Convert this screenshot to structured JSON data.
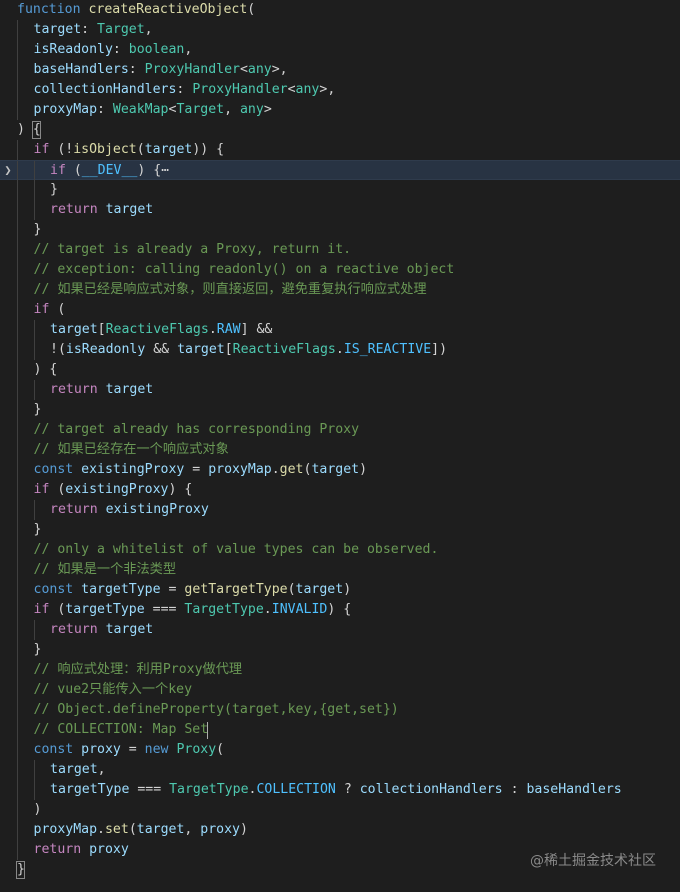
{
  "watermark": "@稀土掘金技术社区",
  "lines": [
    {
      "indent": 0,
      "tokens": [
        [
          "function ",
          "kw"
        ],
        [
          "createReactiveObject",
          "fn"
        ],
        [
          "(",
          "pun"
        ]
      ]
    },
    {
      "indent": 1,
      "tokens": [
        [
          "target",
          "var"
        ],
        [
          ": ",
          "pun"
        ],
        [
          "Target",
          "type"
        ],
        [
          ",",
          "pun"
        ]
      ]
    },
    {
      "indent": 1,
      "tokens": [
        [
          "isReadonly",
          "var"
        ],
        [
          ": ",
          "pun"
        ],
        [
          "boolean",
          "type"
        ],
        [
          ",",
          "pun"
        ]
      ]
    },
    {
      "indent": 1,
      "tokens": [
        [
          "baseHandlers",
          "var"
        ],
        [
          ": ",
          "pun"
        ],
        [
          "ProxyHandler",
          "type"
        ],
        [
          "<",
          "pun"
        ],
        [
          "any",
          "type"
        ],
        [
          ">,",
          "pun"
        ]
      ]
    },
    {
      "indent": 1,
      "tokens": [
        [
          "collectionHandlers",
          "var"
        ],
        [
          ": ",
          "pun"
        ],
        [
          "ProxyHandler",
          "type"
        ],
        [
          "<",
          "pun"
        ],
        [
          "any",
          "type"
        ],
        [
          ">,",
          "pun"
        ]
      ]
    },
    {
      "indent": 1,
      "tokens": [
        [
          "proxyMap",
          "var"
        ],
        [
          ": ",
          "pun"
        ],
        [
          "WeakMap",
          "type"
        ],
        [
          "<",
          "pun"
        ],
        [
          "Target",
          "type"
        ],
        [
          ", ",
          "pun"
        ],
        [
          "any",
          "type"
        ],
        [
          ">",
          "pun"
        ]
      ]
    },
    {
      "indent": 0,
      "tokens": [
        [
          ") {",
          "pun"
        ]
      ]
    },
    {
      "indent": 1,
      "tokens": [
        [
          "if ",
          "ctl"
        ],
        [
          "(!",
          "pun"
        ],
        [
          "isObject",
          "fn"
        ],
        [
          "(",
          "pun"
        ],
        [
          "target",
          "var"
        ],
        [
          ")) {",
          "pun"
        ]
      ]
    },
    {
      "indent": 2,
      "current": true,
      "tokens": [
        [
          "if ",
          "ctl"
        ],
        [
          "(",
          "pun"
        ],
        [
          "__DEV__",
          "cst"
        ],
        [
          ") {",
          "pun"
        ],
        [
          "⋯",
          "fold"
        ]
      ]
    },
    {
      "indent": 2,
      "tokens": [
        [
          "}",
          "pun"
        ]
      ]
    },
    {
      "indent": 2,
      "tokens": [
        [
          "return ",
          "ctl"
        ],
        [
          "target",
          "var"
        ]
      ]
    },
    {
      "indent": 1,
      "tokens": [
        [
          "}",
          "pun"
        ]
      ]
    },
    {
      "indent": 1,
      "tokens": [
        [
          "// target is already a Proxy, return it.",
          "cmt"
        ]
      ]
    },
    {
      "indent": 1,
      "tokens": [
        [
          "// exception: calling readonly() on a reactive object",
          "cmt"
        ]
      ]
    },
    {
      "indent": 1,
      "tokens": [
        [
          "// 如果已经是响应式对象，则直接返回，避免重复执行响应式处理",
          "cmt"
        ]
      ]
    },
    {
      "indent": 1,
      "tokens": [
        [
          "if ",
          "ctl"
        ],
        [
          "(",
          "pun"
        ]
      ]
    },
    {
      "indent": 2,
      "tokens": [
        [
          "target",
          "var"
        ],
        [
          "[",
          "pun"
        ],
        [
          "ReactiveFlags",
          "type"
        ],
        [
          ".",
          "pun"
        ],
        [
          "RAW",
          "cst"
        ],
        [
          "] &&",
          "pun"
        ]
      ]
    },
    {
      "indent": 2,
      "tokens": [
        [
          "!(",
          "pun"
        ],
        [
          "isReadonly",
          "var"
        ],
        [
          " && ",
          "pun"
        ],
        [
          "target",
          "var"
        ],
        [
          "[",
          "pun"
        ],
        [
          "ReactiveFlags",
          "type"
        ],
        [
          ".",
          "pun"
        ],
        [
          "IS_REACTIVE",
          "cst"
        ],
        [
          "])",
          "pun"
        ]
      ]
    },
    {
      "indent": 1,
      "tokens": [
        [
          ") {",
          "pun"
        ]
      ]
    },
    {
      "indent": 2,
      "tokens": [
        [
          "return ",
          "ctl"
        ],
        [
          "target",
          "var"
        ]
      ]
    },
    {
      "indent": 1,
      "tokens": [
        [
          "}",
          "pun"
        ]
      ]
    },
    {
      "indent": 1,
      "tokens": [
        [
          "// target already has corresponding Proxy",
          "cmt"
        ]
      ]
    },
    {
      "indent": 1,
      "tokens": [
        [
          "// 如果已经存在一个响应式对象",
          "cmt"
        ]
      ]
    },
    {
      "indent": 1,
      "tokens": [
        [
          "const ",
          "kw"
        ],
        [
          "existingProxy",
          "var"
        ],
        [
          " = ",
          "pun"
        ],
        [
          "proxyMap",
          "var"
        ],
        [
          ".",
          "pun"
        ],
        [
          "get",
          "fn"
        ],
        [
          "(",
          "pun"
        ],
        [
          "target",
          "var"
        ],
        [
          ")",
          "pun"
        ]
      ]
    },
    {
      "indent": 1,
      "tokens": [
        [
          "if ",
          "ctl"
        ],
        [
          "(",
          "pun"
        ],
        [
          "existingProxy",
          "var"
        ],
        [
          ") {",
          "pun"
        ]
      ]
    },
    {
      "indent": 2,
      "tokens": [
        [
          "return ",
          "ctl"
        ],
        [
          "existingProxy",
          "var"
        ]
      ]
    },
    {
      "indent": 1,
      "tokens": [
        [
          "}",
          "pun"
        ]
      ]
    },
    {
      "indent": 1,
      "tokens": [
        [
          "// only a whitelist of value types can be observed.",
          "cmt"
        ]
      ]
    },
    {
      "indent": 1,
      "tokens": [
        [
          "// 如果是一个非法类型",
          "cmt"
        ]
      ]
    },
    {
      "indent": 1,
      "tokens": [
        [
          "const ",
          "kw"
        ],
        [
          "targetType",
          "var"
        ],
        [
          " = ",
          "pun"
        ],
        [
          "getTargetType",
          "fn"
        ],
        [
          "(",
          "pun"
        ],
        [
          "target",
          "var"
        ],
        [
          ")",
          "pun"
        ]
      ]
    },
    {
      "indent": 1,
      "tokens": [
        [
          "if ",
          "ctl"
        ],
        [
          "(",
          "pun"
        ],
        [
          "targetType",
          "var"
        ],
        [
          " === ",
          "pun"
        ],
        [
          "TargetType",
          "type"
        ],
        [
          ".",
          "pun"
        ],
        [
          "INVALID",
          "cst"
        ],
        [
          ") {",
          "pun"
        ]
      ]
    },
    {
      "indent": 2,
      "tokens": [
        [
          "return ",
          "ctl"
        ],
        [
          "target",
          "var"
        ]
      ]
    },
    {
      "indent": 1,
      "tokens": [
        [
          "}",
          "pun"
        ]
      ]
    },
    {
      "indent": 1,
      "tokens": [
        [
          "// 响应式处理：利用Proxy做代理",
          "cmt"
        ]
      ]
    },
    {
      "indent": 1,
      "tokens": [
        [
          "// vue2只能传入一个key",
          "cmt"
        ]
      ]
    },
    {
      "indent": 1,
      "tokens": [
        [
          "// Object.defineProperty(target,key,{get,set})",
          "cmt"
        ]
      ]
    },
    {
      "indent": 1,
      "tokens": [
        [
          "// COLLECTION: Map Set",
          "cmt"
        ]
      ]
    },
    {
      "indent": 1,
      "tokens": [
        [
          "const ",
          "kw"
        ],
        [
          "proxy",
          "var"
        ],
        [
          " = ",
          "pun"
        ],
        [
          "new ",
          "kw"
        ],
        [
          "Proxy",
          "type"
        ],
        [
          "(",
          "pun"
        ]
      ]
    },
    {
      "indent": 2,
      "tokens": [
        [
          "target",
          "var"
        ],
        [
          ",",
          "pun"
        ]
      ]
    },
    {
      "indent": 2,
      "tokens": [
        [
          "targetType",
          "var"
        ],
        [
          " === ",
          "pun"
        ],
        [
          "TargetType",
          "type"
        ],
        [
          ".",
          "pun"
        ],
        [
          "COLLECTION",
          "cst"
        ],
        [
          " ? ",
          "pun"
        ],
        [
          "collectionHandlers",
          "var"
        ],
        [
          " : ",
          "pun"
        ],
        [
          "baseHandlers",
          "var"
        ]
      ]
    },
    {
      "indent": 1,
      "tokens": [
        [
          ")",
          "pun"
        ]
      ]
    },
    {
      "indent": 1,
      "tokens": [
        [
          "proxyMap",
          "var"
        ],
        [
          ".",
          "pun"
        ],
        [
          "set",
          "fn"
        ],
        [
          "(",
          "pun"
        ],
        [
          "target",
          "var"
        ],
        [
          ", ",
          "pun"
        ],
        [
          "proxy",
          "var"
        ],
        [
          ")",
          "pun"
        ]
      ]
    },
    {
      "indent": 1,
      "tokens": [
        [
          "return ",
          "ctl"
        ],
        [
          "proxy",
          "var"
        ]
      ]
    },
    {
      "indent": 0,
      "tokens": [
        [
          "}",
          "pun"
        ]
      ]
    }
  ]
}
